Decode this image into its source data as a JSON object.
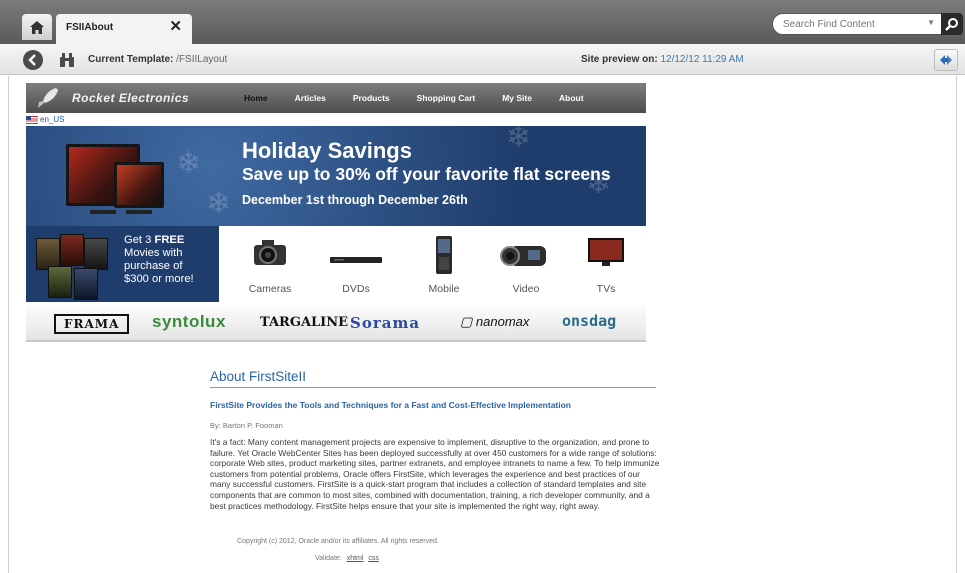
{
  "browser": {
    "tab_title": "FSIIAbout",
    "tab_close": "✕",
    "search": {
      "placeholder": "Search Find Content"
    }
  },
  "toolbar": {
    "current_template_label": "Current Template:",
    "current_template_value": "/FSIILayout",
    "site_preview_label": "Site preview on:",
    "site_preview_value": "12/12/12 11:29 AM"
  },
  "site": {
    "logo": "Rocket Electronics",
    "nav": [
      "Home",
      "Articles",
      "Products",
      "Shopping Cart",
      "My Site",
      "About"
    ],
    "locale": "en_US",
    "banner": {
      "title": "Holiday Savings",
      "subtitle": "Save up to 30% off your favorite flat screens",
      "dates": "December 1st through December 26th"
    },
    "promo": {
      "line1": "Get 3 ",
      "line1_bold": "FREE",
      "line2": "Movies with",
      "line3": "purchase of",
      "line4": "$300 or more!"
    },
    "categories": [
      "Cameras",
      "DVDs",
      "Mobile",
      "Video",
      "TVs"
    ],
    "brands": [
      "FRAMA",
      "syntolux",
      "TARGALINE",
      "Sorama",
      "nanomax",
      "onsdag"
    ]
  },
  "article": {
    "title": "About FirstSiteII",
    "heading": "FirstSite Provides the Tools and Techniques for a Fast and Cost-Effective Implementation",
    "byline": "By: Barton P. Fooman",
    "body": "It's a fact: Many content management projects are expensive to implement, disruptive to the organization, and prone to failure. Yet Oracle WebCenter Sites has been deployed successfully at over 450 customers for a wide range of solutions: corporate Web sites, product marketing sites, partner extranets, and employee intranets to name a few. To help immunize customers from potential problems, Oracle offers FirstSite, which leverages the experience and best practices of our many successful customers. FirstSite is a quick-start program that includes a collection of standard templates and site components that are common to most sites, combined with documentation, training, a rich developer community, and a best practices methodology. FirstSite helps ensure that your site is implemented the right way, right away.",
    "copyright": "Copyright (c) 2012, Oracle and/or its affiliates. All rights reserved.",
    "validate_label": "Validate:",
    "validate_links": [
      "xhtml",
      "css"
    ]
  }
}
